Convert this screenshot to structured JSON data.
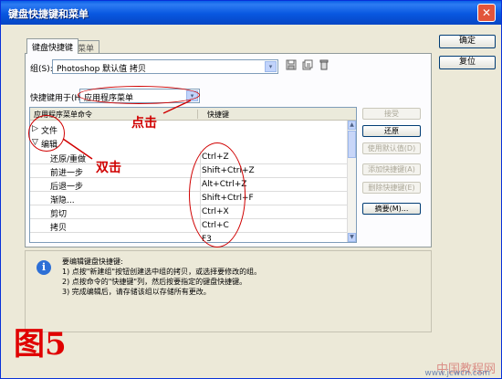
{
  "window": {
    "title": "键盘快捷键和菜单",
    "close_glyph": "✕"
  },
  "tabs": [
    {
      "label": "键盘快捷键"
    },
    {
      "label": "菜单"
    }
  ],
  "set": {
    "label": "组(S):",
    "value": "Photoshop 默认值 拷贝",
    "arrow": "▾"
  },
  "toolbar": {
    "save_icon": "save-icon",
    "save_as_icon": "save-as-icon",
    "delete_icon": "delete-icon"
  },
  "shortcuts_for": {
    "label": "快捷键用于(H):",
    "value": "应用程序菜单",
    "arrow": "▾"
  },
  "grid": {
    "col_command": "应用程序菜单命令",
    "col_shortcut": "快捷键",
    "groups": [
      {
        "label": "文件",
        "glyph": "▷"
      },
      {
        "label": "编辑",
        "glyph": "▽"
      }
    ],
    "rows": [
      {
        "command": "还原/重做",
        "shortcut": "Ctrl+Z"
      },
      {
        "command": "前进一步",
        "shortcut": "Shift+Ctrl+Z"
      },
      {
        "command": "后退一步",
        "shortcut": "Alt+Ctrl+Z"
      },
      {
        "command": "渐隐...",
        "shortcut": "Shift+Ctrl+F"
      },
      {
        "command": "剪切",
        "shortcut": "Ctrl+X"
      },
      {
        "command": "拷贝",
        "shortcut": "Ctrl+C"
      },
      {
        "command": "",
        "shortcut": "F3"
      }
    ]
  },
  "buttons": {
    "ok": "确定",
    "reset": "复位",
    "accept": "接受",
    "undo": "还原",
    "use_default": "使用默认值(D)",
    "add_shortcut": "添加快捷键(A)",
    "delete_shortcut": "删除快捷键(E)",
    "summarize": "摘要(M)..."
  },
  "info": {
    "heading": "要编辑键盘快捷键:",
    "lines": [
      "1) 点按\"新建组\"按钮创建选中组的拷贝，或选择要修改的组。",
      "2) 点按命令的\"快捷键\"列，然后按要指定的键盘快捷键。",
      "3) 完成编辑后，请存储该组以存储所有更改。"
    ]
  },
  "annotations": {
    "click": "点击",
    "double_click": "双击",
    "figure": "图5"
  },
  "watermark": {
    "main": "中国教程网",
    "sub": "www.jcwcn.com"
  }
}
